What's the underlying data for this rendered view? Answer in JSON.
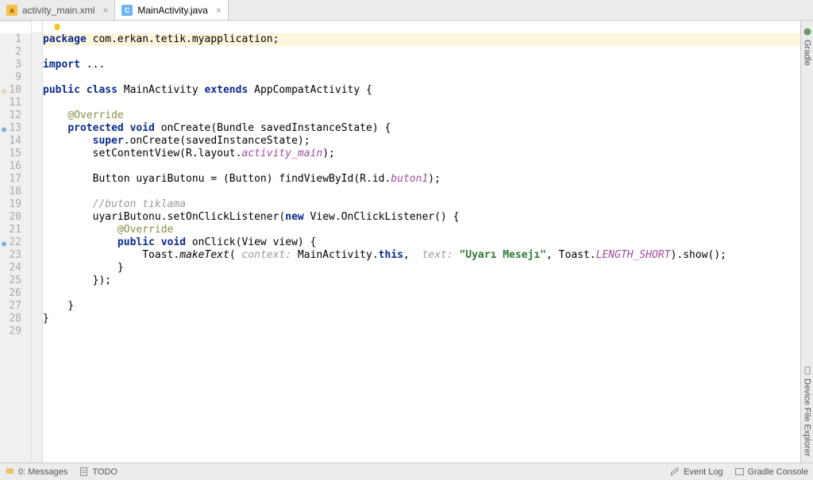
{
  "tabs": [
    {
      "label": "activity_main.xml",
      "iconLetter": "a",
      "active": false
    },
    {
      "label": "MainActivity.java",
      "iconLetter": "C",
      "active": true
    }
  ],
  "gutterLines": [
    "1",
    "2",
    "3",
    "9",
    "10",
    "11",
    "12",
    "13",
    "14",
    "15",
    "16",
    "17",
    "18",
    "19",
    "20",
    "21",
    "22",
    "23",
    "24",
    "25",
    "26",
    "27",
    "28",
    "29"
  ],
  "code": {
    "l1a": "package",
    "l1b": " com.erkan.tetik.myapplication;",
    "l3a": "import",
    "l3b": " ...",
    "l10a": "public class",
    "l10b": " MainActivity ",
    "l10c": "extends",
    "l10d": " AppCompatActivity {",
    "l12": "@Override",
    "l13a": "protected void",
    "l13b": " onCreate(Bundle savedInstanceState) {",
    "l14a": "super",
    "l14b": ".onCreate(savedInstanceState);",
    "l15a": "        setContentView(R.layout.",
    "l15b": "activity_main",
    "l15c": ");",
    "l17a": "        Button uyariButonu = (Button) findViewById(R.id.",
    "l17b": "buton1",
    "l17c": ");",
    "l19": "//buton tıklama",
    "l20a": "        uyariButonu.setOnClickListener(",
    "l20b": "new",
    "l20c": " View.OnClickListener() {",
    "l21": "@Override",
    "l22a": "public void",
    "l22b": " onClick(View view) {",
    "l23a": "                Toast.",
    "l23b": "makeText",
    "l23c": "( ",
    "l23d": "context:",
    "l23e": " MainActivity.",
    "l23f": "this",
    "l23g": ",  ",
    "l23h": "text:",
    "l23i": " ",
    "l23j": "\"Uyarı Mesejı\"",
    "l23k": ", Toast.",
    "l23l": "LENGTH_SHORT",
    "l23m": ").show();",
    "l24": "            }",
    "l25": "        });",
    "l27": "    }",
    "l28": "}"
  },
  "sideTabs": {
    "gradle": "Gradle",
    "device": "Device File Explorer"
  },
  "status": {
    "messages": "0: Messages",
    "todo": "TODO",
    "eventlog": "Event Log",
    "gradleconsole": "Gradle Console"
  }
}
